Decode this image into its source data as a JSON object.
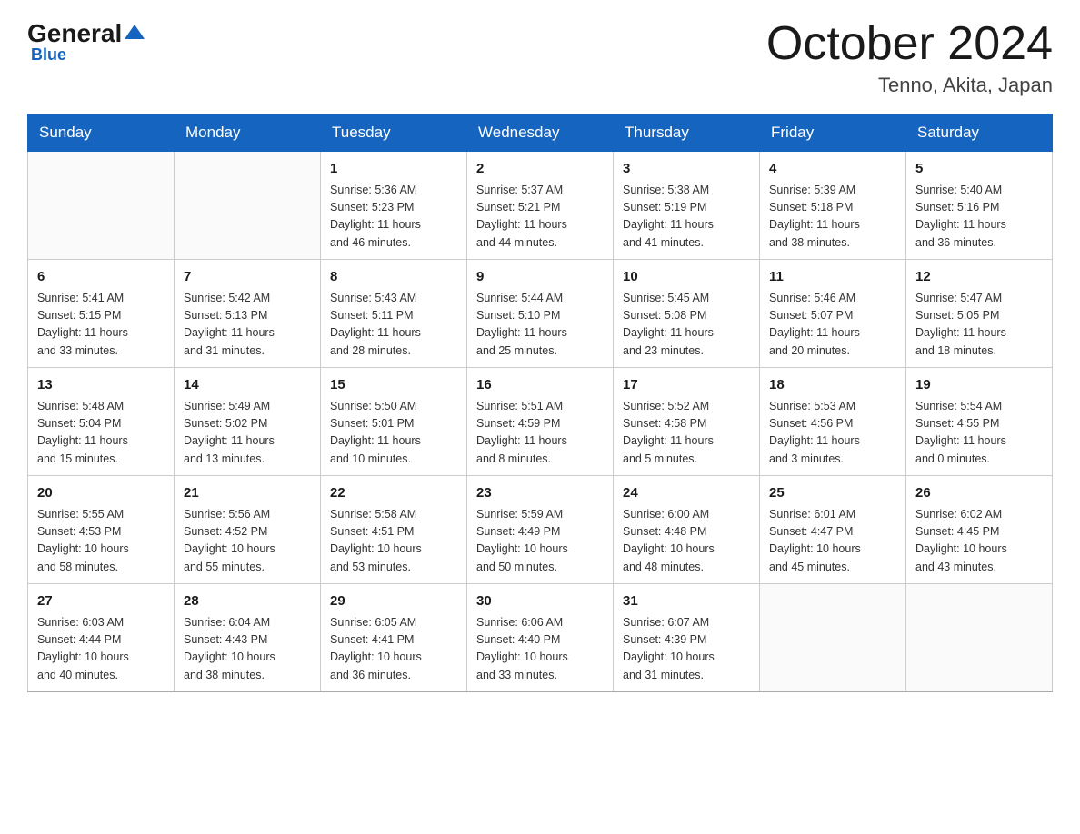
{
  "header": {
    "logo_general": "General",
    "logo_blue": "Blue",
    "title": "October 2024",
    "subtitle": "Tenno, Akita, Japan"
  },
  "weekdays": [
    "Sunday",
    "Monday",
    "Tuesday",
    "Wednesday",
    "Thursday",
    "Friday",
    "Saturday"
  ],
  "weeks": [
    [
      {
        "day": "",
        "info": ""
      },
      {
        "day": "",
        "info": ""
      },
      {
        "day": "1",
        "info": "Sunrise: 5:36 AM\nSunset: 5:23 PM\nDaylight: 11 hours\nand 46 minutes."
      },
      {
        "day": "2",
        "info": "Sunrise: 5:37 AM\nSunset: 5:21 PM\nDaylight: 11 hours\nand 44 minutes."
      },
      {
        "day": "3",
        "info": "Sunrise: 5:38 AM\nSunset: 5:19 PM\nDaylight: 11 hours\nand 41 minutes."
      },
      {
        "day": "4",
        "info": "Sunrise: 5:39 AM\nSunset: 5:18 PM\nDaylight: 11 hours\nand 38 minutes."
      },
      {
        "day": "5",
        "info": "Sunrise: 5:40 AM\nSunset: 5:16 PM\nDaylight: 11 hours\nand 36 minutes."
      }
    ],
    [
      {
        "day": "6",
        "info": "Sunrise: 5:41 AM\nSunset: 5:15 PM\nDaylight: 11 hours\nand 33 minutes."
      },
      {
        "day": "7",
        "info": "Sunrise: 5:42 AM\nSunset: 5:13 PM\nDaylight: 11 hours\nand 31 minutes."
      },
      {
        "day": "8",
        "info": "Sunrise: 5:43 AM\nSunset: 5:11 PM\nDaylight: 11 hours\nand 28 minutes."
      },
      {
        "day": "9",
        "info": "Sunrise: 5:44 AM\nSunset: 5:10 PM\nDaylight: 11 hours\nand 25 minutes."
      },
      {
        "day": "10",
        "info": "Sunrise: 5:45 AM\nSunset: 5:08 PM\nDaylight: 11 hours\nand 23 minutes."
      },
      {
        "day": "11",
        "info": "Sunrise: 5:46 AM\nSunset: 5:07 PM\nDaylight: 11 hours\nand 20 minutes."
      },
      {
        "day": "12",
        "info": "Sunrise: 5:47 AM\nSunset: 5:05 PM\nDaylight: 11 hours\nand 18 minutes."
      }
    ],
    [
      {
        "day": "13",
        "info": "Sunrise: 5:48 AM\nSunset: 5:04 PM\nDaylight: 11 hours\nand 15 minutes."
      },
      {
        "day": "14",
        "info": "Sunrise: 5:49 AM\nSunset: 5:02 PM\nDaylight: 11 hours\nand 13 minutes."
      },
      {
        "day": "15",
        "info": "Sunrise: 5:50 AM\nSunset: 5:01 PM\nDaylight: 11 hours\nand 10 minutes."
      },
      {
        "day": "16",
        "info": "Sunrise: 5:51 AM\nSunset: 4:59 PM\nDaylight: 11 hours\nand 8 minutes."
      },
      {
        "day": "17",
        "info": "Sunrise: 5:52 AM\nSunset: 4:58 PM\nDaylight: 11 hours\nand 5 minutes."
      },
      {
        "day": "18",
        "info": "Sunrise: 5:53 AM\nSunset: 4:56 PM\nDaylight: 11 hours\nand 3 minutes."
      },
      {
        "day": "19",
        "info": "Sunrise: 5:54 AM\nSunset: 4:55 PM\nDaylight: 11 hours\nand 0 minutes."
      }
    ],
    [
      {
        "day": "20",
        "info": "Sunrise: 5:55 AM\nSunset: 4:53 PM\nDaylight: 10 hours\nand 58 minutes."
      },
      {
        "day": "21",
        "info": "Sunrise: 5:56 AM\nSunset: 4:52 PM\nDaylight: 10 hours\nand 55 minutes."
      },
      {
        "day": "22",
        "info": "Sunrise: 5:58 AM\nSunset: 4:51 PM\nDaylight: 10 hours\nand 53 minutes."
      },
      {
        "day": "23",
        "info": "Sunrise: 5:59 AM\nSunset: 4:49 PM\nDaylight: 10 hours\nand 50 minutes."
      },
      {
        "day": "24",
        "info": "Sunrise: 6:00 AM\nSunset: 4:48 PM\nDaylight: 10 hours\nand 48 minutes."
      },
      {
        "day": "25",
        "info": "Sunrise: 6:01 AM\nSunset: 4:47 PM\nDaylight: 10 hours\nand 45 minutes."
      },
      {
        "day": "26",
        "info": "Sunrise: 6:02 AM\nSunset: 4:45 PM\nDaylight: 10 hours\nand 43 minutes."
      }
    ],
    [
      {
        "day": "27",
        "info": "Sunrise: 6:03 AM\nSunset: 4:44 PM\nDaylight: 10 hours\nand 40 minutes."
      },
      {
        "day": "28",
        "info": "Sunrise: 6:04 AM\nSunset: 4:43 PM\nDaylight: 10 hours\nand 38 minutes."
      },
      {
        "day": "29",
        "info": "Sunrise: 6:05 AM\nSunset: 4:41 PM\nDaylight: 10 hours\nand 36 minutes."
      },
      {
        "day": "30",
        "info": "Sunrise: 6:06 AM\nSunset: 4:40 PM\nDaylight: 10 hours\nand 33 minutes."
      },
      {
        "day": "31",
        "info": "Sunrise: 6:07 AM\nSunset: 4:39 PM\nDaylight: 10 hours\nand 31 minutes."
      },
      {
        "day": "",
        "info": ""
      },
      {
        "day": "",
        "info": ""
      }
    ]
  ]
}
